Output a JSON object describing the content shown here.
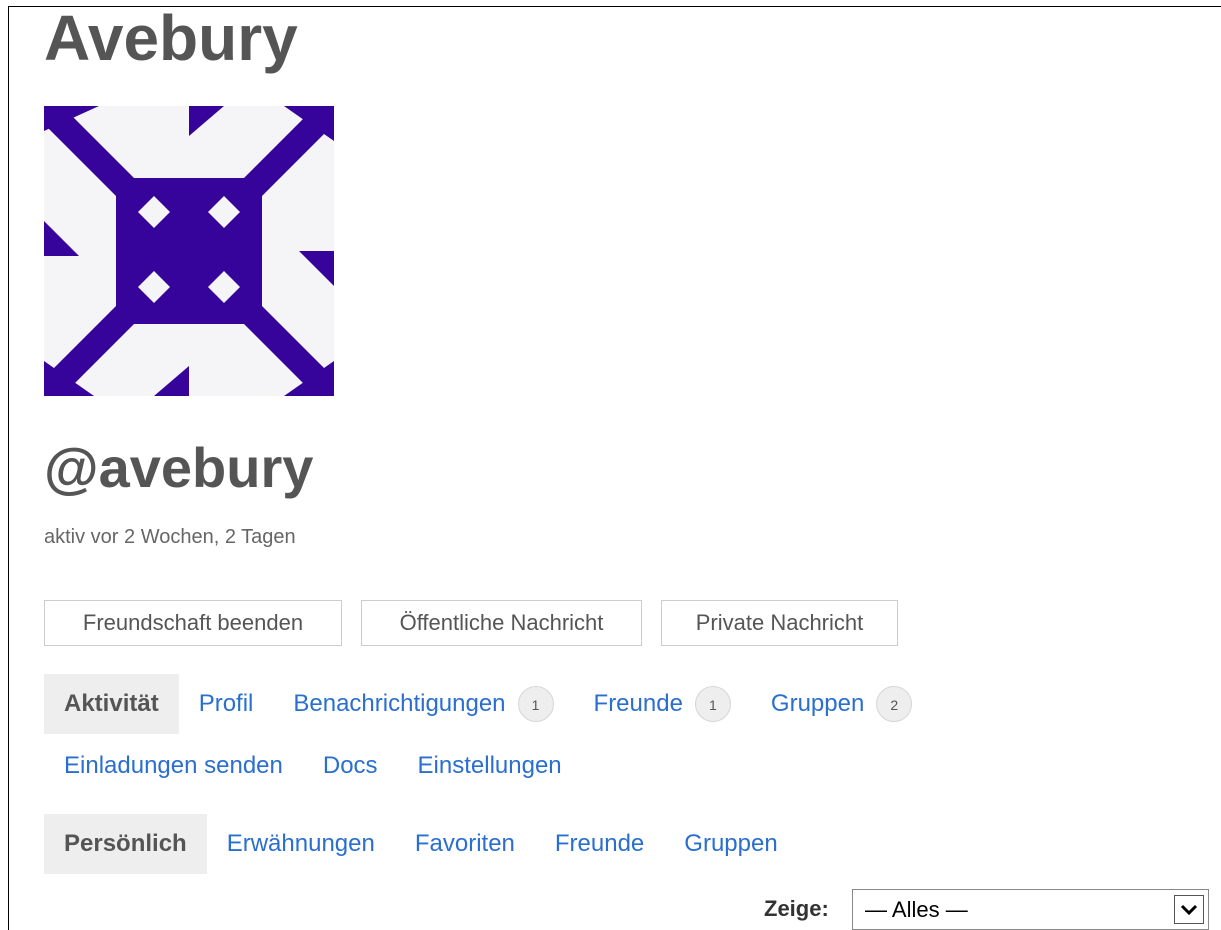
{
  "site": {
    "title": "Avebury"
  },
  "profile": {
    "avatar_color": "#37049b",
    "username": "@avebury",
    "last_active": "aktiv vor 2 Wochen, 2 Tagen"
  },
  "actions": {
    "unfriend_label": "Freundschaft beenden",
    "public_message_label": "Öffentliche Nachricht",
    "private_message_label": "Private Nachricht"
  },
  "nav": {
    "items": [
      {
        "label": "Aktivität",
        "current": true
      },
      {
        "label": "Profil"
      },
      {
        "label": "Benachrichtigungen",
        "count": "1"
      },
      {
        "label": "Freunde",
        "count": "1"
      },
      {
        "label": "Gruppen",
        "count": "2"
      },
      {
        "label": "Einladungen senden"
      },
      {
        "label": "Docs"
      },
      {
        "label": "Einstellungen"
      }
    ]
  },
  "subnav": {
    "items": [
      {
        "label": "Persönlich",
        "current": true
      },
      {
        "label": "Erwähnungen"
      },
      {
        "label": "Favoriten"
      },
      {
        "label": "Freunde"
      },
      {
        "label": "Gruppen"
      }
    ]
  },
  "filter": {
    "label": "Zeige:",
    "selected": "— Alles —",
    "arrow_icon": "chevron-down-icon"
  },
  "colors": {
    "link": "#2a6fcf",
    "text": "#555555",
    "current_tab_bg": "#eeeeee"
  }
}
